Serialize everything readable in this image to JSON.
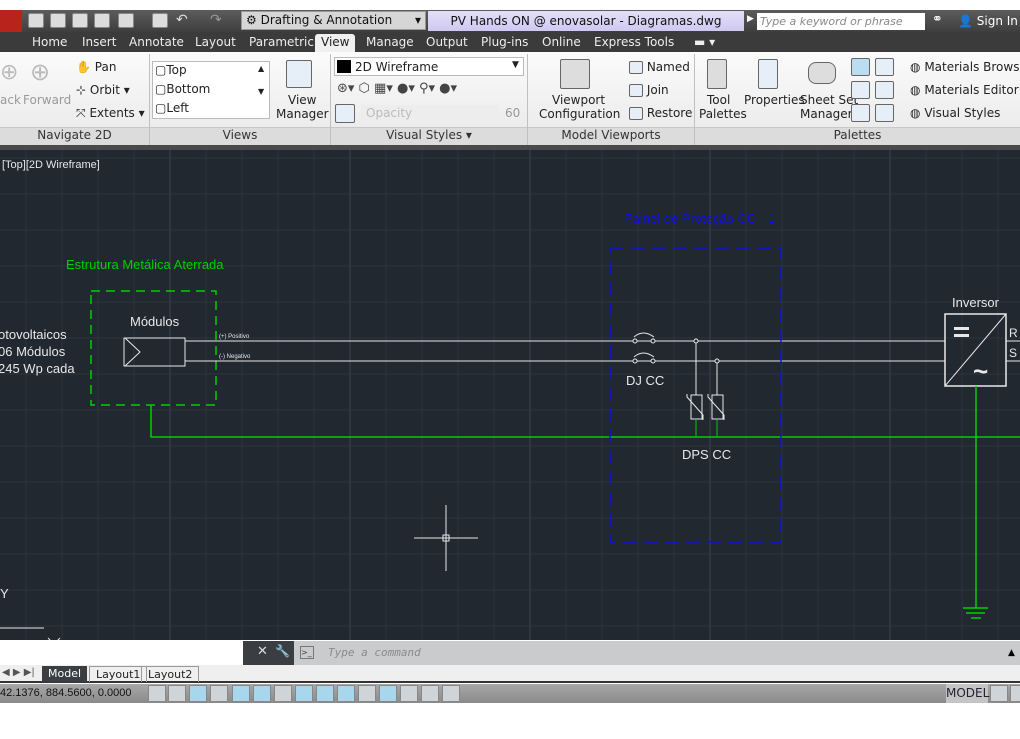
{
  "titlebar": {
    "workspace": "Drafting & Annotation",
    "document_title": "PV Hands ON @ enovasolar - Diagramas.dwg",
    "search_placeholder": "Type a keyword or phrase",
    "sign_in": "Sign In"
  },
  "tabs": [
    "Home",
    "Insert",
    "Annotate",
    "Layout",
    "Parametric",
    "View",
    "Manage",
    "Output",
    "Plug-ins",
    "Online",
    "Express Tools"
  ],
  "active_tab": "View",
  "ribbon": {
    "navigate": {
      "back": "ack",
      "forward": "Forward",
      "pan": "Pan",
      "orbit": "Orbit",
      "extents": "Extents",
      "label": "Navigate 2D"
    },
    "views": {
      "items": [
        "Top",
        "Bottom",
        "Left"
      ],
      "view_manager": [
        "View",
        "Manager"
      ],
      "label": "Views"
    },
    "visual_styles": {
      "current": "2D Wireframe",
      "opacity_label": "Opacity",
      "opacity_value": "60",
      "label": "Visual Styles"
    },
    "model_viewports": {
      "config": [
        "Viewport",
        "Configuration"
      ],
      "named": "Named",
      "join": "Join",
      "restore": "Restore",
      "label": "Model Viewports"
    },
    "palettes": {
      "tool": [
        "Tool",
        "Palettes"
      ],
      "properties": "Properties",
      "sheet_set": [
        "Sheet Set",
        "Manager"
      ],
      "materials_browser": "Materials Browser",
      "materials_editor": "Materials Editor",
      "visual_styles": "Visual Styles",
      "label": "Palettes"
    }
  },
  "viewport_label": "[Top][2D Wireframe]",
  "drawing": {
    "structure_label": "Estrutura Metálica Aterrada",
    "modules_label": "Módulos",
    "pv_text": [
      "otovoltaicos",
      "06 Módulos",
      "245 Wp cada"
    ],
    "positive": "(+) Positivo",
    "negative": "(-) Negativo",
    "panel_label": "Painel de Proteção CC - 1",
    "breaker_label": "DJ CC",
    "surge_label": "DPS CC",
    "inverter_label": "Inversor",
    "phase_r": "R",
    "phase_s": "S",
    "ucs_y": "Y",
    "colors": {
      "background": "#212830",
      "green": "#00d000",
      "blue": "#1010e0",
      "white": "#e8e8e8"
    }
  },
  "command": {
    "placeholder": "Type a command"
  },
  "layout_tabs": [
    "Model",
    "Layout1",
    "Layout2"
  ],
  "status": {
    "coordinates": "42.1376, 884.5600, 0.0000",
    "model": "MODEL"
  }
}
